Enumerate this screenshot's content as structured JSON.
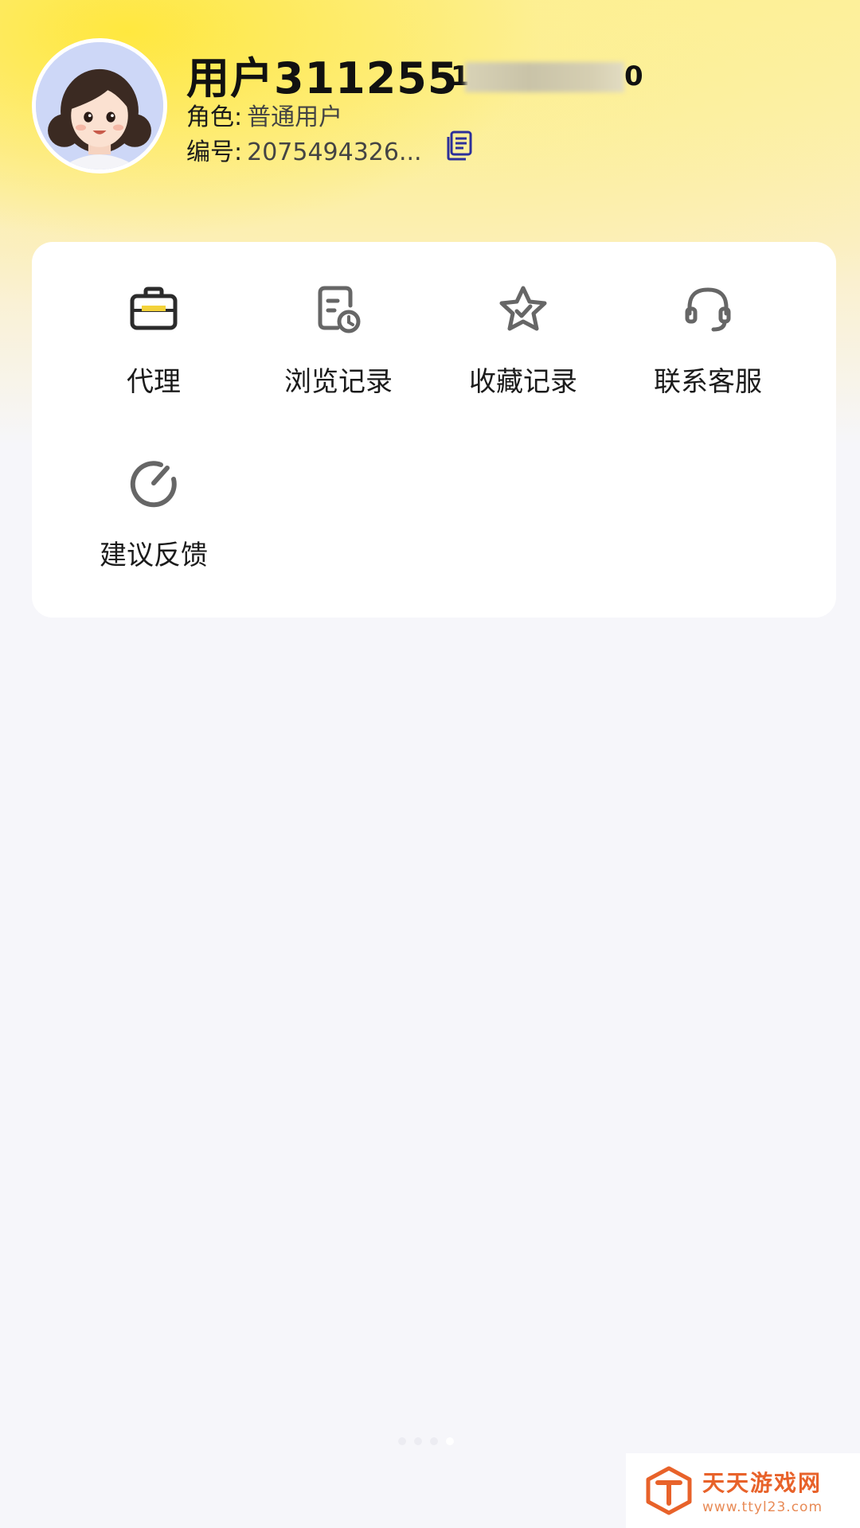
{
  "profile": {
    "username": "用户311255",
    "phone_prefix": "1",
    "phone_suffix": "0",
    "role_label": "角色:",
    "role_value": "普通用户",
    "id_label": "编号:",
    "id_value": "2075494326..."
  },
  "menu": {
    "items": [
      {
        "label": "代理",
        "icon": "briefcase-icon"
      },
      {
        "label": "浏览记录",
        "icon": "browse-history-icon"
      },
      {
        "label": "收藏记录",
        "icon": "star-check-icon"
      },
      {
        "label": "联系客服",
        "icon": "headset-icon"
      },
      {
        "label": "建议反馈",
        "icon": "feedback-icon"
      }
    ]
  },
  "watermark": {
    "title": "天天游戏网",
    "url": "www.ttyl23.com"
  },
  "colors": {
    "accent_yellow": "#ffe73a",
    "card_bg": "#ffffff",
    "page_bg": "#f6f6fa",
    "copy_icon": "#2c2f9a",
    "watermark": "#e8622a"
  }
}
